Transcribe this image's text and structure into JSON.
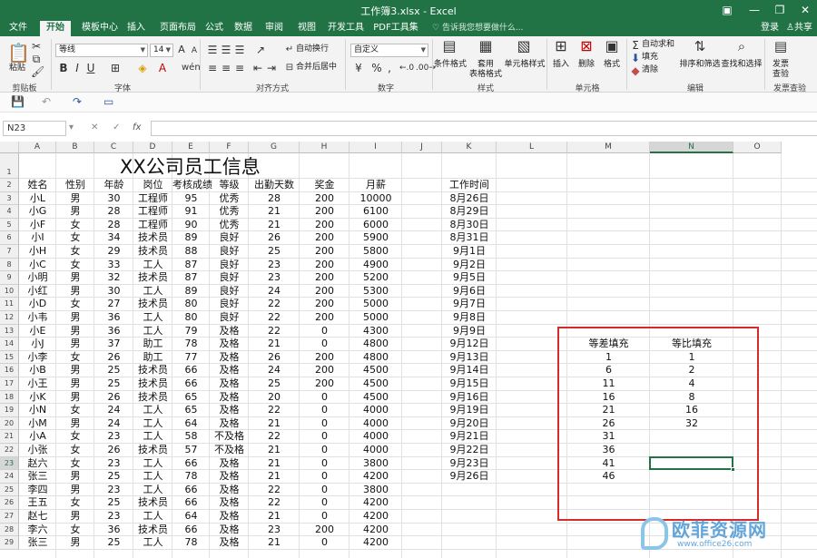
{
  "window": {
    "title": "工作簿3.xlsx - Excel"
  },
  "tabs": [
    "文件",
    "开始",
    "模板中心",
    "插入",
    "页面布局",
    "公式",
    "数据",
    "审阅",
    "视图",
    "开发工具",
    "PDF工具集"
  ],
  "active_tab": "开始",
  "tellme": "告诉我您想要做什么...",
  "signin": "登录",
  "share": "共享",
  "ribbon": {
    "clipboard": {
      "paste": "粘贴",
      "label": "剪贴板"
    },
    "font": {
      "name": "等线",
      "size": "14",
      "label": "字体",
      "bold": "B",
      "italic": "I",
      "underline": "U",
      "grow": "A",
      "shrink": "A"
    },
    "alignment": {
      "wrap": "自动换行",
      "merge": "合并后居中",
      "label": "对齐方式"
    },
    "number": {
      "format": "自定义",
      "label": "数字",
      "currency": "¥",
      "percent": "%",
      "comma": ","
    },
    "styles": {
      "conditional": "条件格式",
      "table1": "套用",
      "table2": "表格格式",
      "cell_styles": "单元格样式",
      "label": "样式"
    },
    "cells": {
      "insert": "插入",
      "delete": "删除",
      "format": "格式",
      "label": "单元格"
    },
    "editing": {
      "autosum": "自动求和",
      "fill": "填充",
      "clear": "清除",
      "sort": "排序和筛选",
      "find": "查找和选择",
      "label": "编辑"
    },
    "invoice": {
      "line1": "发票",
      "line2": "查验",
      "label": "发票查验"
    }
  },
  "namebox": "N23",
  "fx": "fx",
  "columns": [
    "A",
    "B",
    "C",
    "D",
    "E",
    "F",
    "G",
    "H",
    "I",
    "J",
    "K",
    "L",
    "M",
    "N",
    "O"
  ],
  "selected_column": "N",
  "rows": [
    "1",
    "2",
    "3",
    "4",
    "5",
    "6",
    "7",
    "8",
    "9",
    "10",
    "11",
    "12",
    "13",
    "14",
    "15",
    "16",
    "17",
    "18",
    "19",
    "20",
    "21",
    "22",
    "23",
    "24",
    "25",
    "26",
    "27",
    "28",
    "29"
  ],
  "selected_row": "23",
  "sheet": {
    "title": "XX公司员工信息",
    "headers": [
      "姓名",
      "性别",
      "年龄",
      "岗位",
      "考核成绩",
      "等级",
      "出勤天数",
      "奖金",
      "月薪"
    ],
    "work_time_header": "工作时间",
    "records": [
      [
        "小L",
        "男",
        "30",
        "工程师",
        "95",
        "优秀",
        "28",
        "200",
        "10000"
      ],
      [
        "小G",
        "男",
        "28",
        "工程师",
        "91",
        "优秀",
        "21",
        "200",
        "6100"
      ],
      [
        "小F",
        "女",
        "28",
        "工程师",
        "90",
        "优秀",
        "21",
        "200",
        "6000"
      ],
      [
        "小I",
        "女",
        "34",
        "技术员",
        "89",
        "良好",
        "26",
        "200",
        "5900"
      ],
      [
        "小H",
        "女",
        "29",
        "技术员",
        "88",
        "良好",
        "25",
        "200",
        "5800"
      ],
      [
        "小C",
        "女",
        "33",
        "工人",
        "87",
        "良好",
        "23",
        "200",
        "4900"
      ],
      [
        "小明",
        "男",
        "32",
        "技术员",
        "87",
        "良好",
        "23",
        "200",
        "5200"
      ],
      [
        "小红",
        "男",
        "30",
        "工人",
        "89",
        "良好",
        "24",
        "200",
        "5300"
      ],
      [
        "小D",
        "女",
        "27",
        "技术员",
        "80",
        "良好",
        "22",
        "200",
        "5000"
      ],
      [
        "小韦",
        "男",
        "36",
        "工人",
        "80",
        "良好",
        "22",
        "200",
        "5000"
      ],
      [
        "小E",
        "男",
        "36",
        "工人",
        "79",
        "及格",
        "22",
        "0",
        "4300"
      ],
      [
        "小J",
        "男",
        "37",
        "助工",
        "78",
        "及格",
        "21",
        "0",
        "4800"
      ],
      [
        "小李",
        "女",
        "26",
        "助工",
        "77",
        "及格",
        "26",
        "200",
        "4800"
      ],
      [
        "小B",
        "男",
        "25",
        "技术员",
        "66",
        "及格",
        "24",
        "200",
        "4500"
      ],
      [
        "小王",
        "男",
        "25",
        "技术员",
        "66",
        "及格",
        "25",
        "200",
        "4500"
      ],
      [
        "小K",
        "男",
        "26",
        "技术员",
        "65",
        "及格",
        "20",
        "0",
        "4500"
      ],
      [
        "小N",
        "女",
        "24",
        "工人",
        "65",
        "及格",
        "22",
        "0",
        "4000"
      ],
      [
        "小M",
        "男",
        "24",
        "工人",
        "64",
        "及格",
        "21",
        "0",
        "4000"
      ],
      [
        "小A",
        "女",
        "23",
        "工人",
        "58",
        "不及格",
        "22",
        "0",
        "4000"
      ],
      [
        "小张",
        "女",
        "26",
        "技术员",
        "57",
        "不及格",
        "21",
        "0",
        "4000"
      ],
      [
        "赵六",
        "女",
        "23",
        "工人",
        "66",
        "及格",
        "21",
        "0",
        "3800"
      ],
      [
        "张三",
        "男",
        "25",
        "工人",
        "78",
        "及格",
        "21",
        "0",
        "4200"
      ],
      [
        "李四",
        "男",
        "23",
        "工人",
        "66",
        "及格",
        "22",
        "0",
        "3800"
      ],
      [
        "王五",
        "女",
        "25",
        "技术员",
        "66",
        "及格",
        "22",
        "0",
        "4200"
      ],
      [
        "赵七",
        "男",
        "23",
        "工人",
        "64",
        "及格",
        "21",
        "0",
        "4200"
      ],
      [
        "李六",
        "女",
        "36",
        "技术员",
        "66",
        "及格",
        "23",
        "200",
        "4200"
      ],
      [
        "张三",
        "男",
        "25",
        "工人",
        "78",
        "及格",
        "21",
        "0",
        "4200"
      ]
    ],
    "work_times": [
      "8月26日",
      "8月29日",
      "8月30日",
      "8月31日",
      "9月1日",
      "9月2日",
      "9月5日",
      "9月6日",
      "9月7日",
      "9月8日",
      "9月9日",
      "9月12日",
      "9月13日",
      "9月14日",
      "9月15日",
      "9月16日",
      "9月19日",
      "9月20日",
      "9月21日",
      "9月22日",
      "9月23日",
      "9月26日"
    ],
    "arith_header": "等差填充",
    "geo_header": "等比填充",
    "arith": [
      "1",
      "6",
      "11",
      "16",
      "21",
      "26",
      "31",
      "36",
      "41",
      "46"
    ],
    "geo": [
      "1",
      "2",
      "4",
      "8",
      "16",
      "32"
    ]
  },
  "watermark": {
    "text": "欧菲资源网",
    "url": "www.office26.com"
  }
}
